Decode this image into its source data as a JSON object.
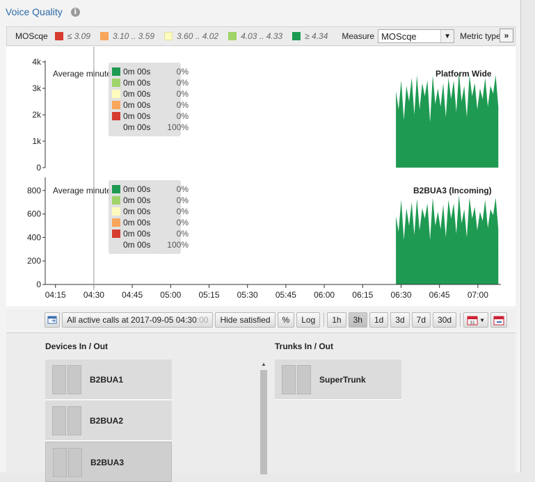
{
  "panel": {
    "title": "Voice Quality",
    "info_icon": "info-icon"
  },
  "legend": {
    "label": "MOScqe",
    "items": [
      {
        "text": "≤ 3.09",
        "color": "#d63b2f"
      },
      {
        "text": "3.10 .. 3.59",
        "color": "#f7a65b"
      },
      {
        "text": "3.60 .. 4.02",
        "color": "#fdfbbd"
      },
      {
        "text": "4.03 .. 4.33",
        "color": "#9fd46a"
      },
      {
        "text": "≥ 4.34",
        "color": "#1e9a52"
      }
    ],
    "measure_label": "Measure",
    "measure_value": "MOScqe",
    "metric_label": "Metric type",
    "next_label": "»"
  },
  "popup_rows": [
    {
      "time": "0m 00s",
      "pct": "0%",
      "color": "#1e9a52"
    },
    {
      "time": "0m 00s",
      "pct": "0%",
      "color": "#9fd46a"
    },
    {
      "time": "0m 00s",
      "pct": "0%",
      "color": "#fdfbbd"
    },
    {
      "time": "0m 00s",
      "pct": "0%",
      "color": "#f7a65b"
    },
    {
      "time": "0m 00s",
      "pct": "0%",
      "color": "#d63b2f"
    },
    {
      "time": "0m 00s",
      "pct": "100%",
      "color": ""
    }
  ],
  "chart_data": [
    {
      "type": "area",
      "title": "Platform Wide",
      "annotation": "Average minute",
      "y_ticks": [
        "4k",
        "3k",
        "2k",
        "1k",
        "0"
      ],
      "ylim": [
        0,
        4000
      ],
      "color": "#1e9a52",
      "x": [
        "04:15",
        "04:30",
        "04:45",
        "05:00",
        "05:15",
        "05:30",
        "05:45",
        "06:00",
        "06:15",
        "06:30",
        "06:45",
        "07:00"
      ],
      "series_start": "06:28",
      "series_end": "07:08",
      "values": [
        2900,
        2200,
        3300,
        1800,
        3100,
        2500,
        3400,
        2000,
        3500,
        2200,
        3200,
        2700,
        3300,
        1700,
        3500,
        2400,
        3000,
        2300,
        3200,
        1900,
        3400,
        2600,
        3300,
        2100,
        3600,
        2500,
        3100,
        1900,
        3500,
        2700,
        3200,
        2200,
        3000,
        2600,
        3400,
        2300,
        3100,
        2800,
        3500,
        2300
      ]
    },
    {
      "type": "area",
      "title": "B2BUA3 (Incoming)",
      "annotation": "Average minute",
      "y_ticks": [
        "800",
        "600",
        "400",
        "200",
        "0"
      ],
      "ylim": [
        0,
        900
      ],
      "color": "#1e9a52",
      "x": [
        "04:15",
        "04:30",
        "04:45",
        "05:00",
        "05:15",
        "05:30",
        "05:45",
        "06:00",
        "06:15",
        "06:30",
        "06:45",
        "07:00"
      ],
      "series_start": "06:28",
      "series_end": "07:08",
      "values": [
        580,
        450,
        720,
        380,
        650,
        500,
        700,
        420,
        730,
        460,
        650,
        560,
        690,
        380,
        740,
        500,
        620,
        470,
        680,
        400,
        720,
        560,
        690,
        430,
        760,
        520,
        640,
        400,
        740,
        560,
        660,
        460,
        620,
        540,
        720,
        480,
        640,
        590,
        740,
        470
      ]
    }
  ],
  "cursor_time": "04:30",
  "toolbar": {
    "calls_label_prefix": "All active calls at 2017-09-05 04:30",
    "calls_label_suffix": ":00",
    "hide_label": "Hide satisfied",
    "pct_label": "%",
    "log_label": "Log",
    "ranges": [
      "1h",
      "3h",
      "1d",
      "3d",
      "7d",
      "30d"
    ],
    "active_range": "3h",
    "calendar_day": "31"
  },
  "devices": {
    "devices_title": "Devices In / Out",
    "trunks_title": "Trunks In / Out",
    "device_items": [
      "B2BUA1",
      "B2BUA2",
      "B2BUA3"
    ],
    "trunk_items": [
      "SuperTrunk"
    ],
    "selected_device": "B2BUA3"
  }
}
